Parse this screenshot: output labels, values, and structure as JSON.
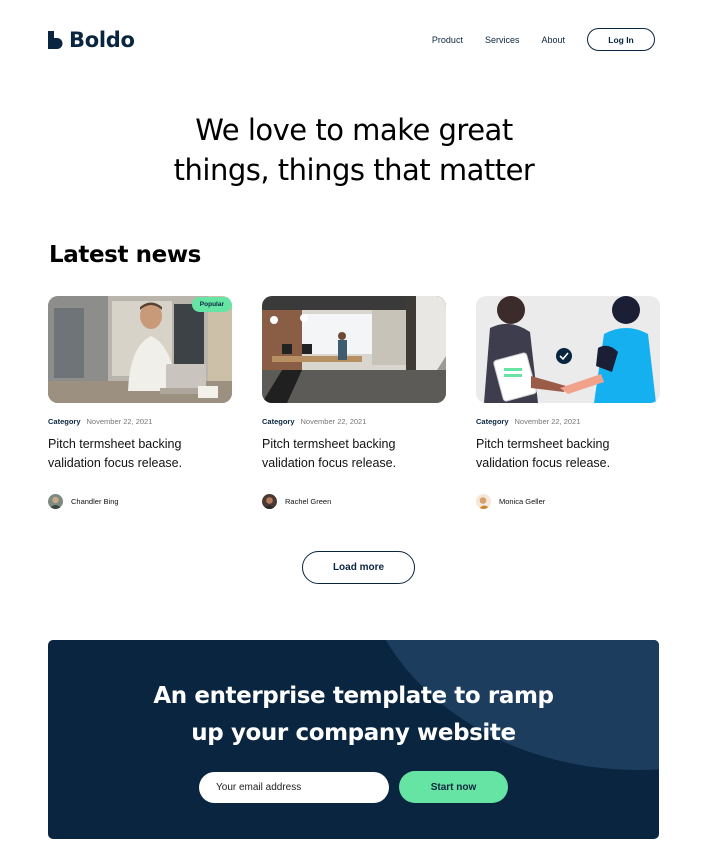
{
  "brand": {
    "name": "Boldo",
    "color": "#0a2540",
    "accent": "#65e4a3"
  },
  "nav": {
    "items": [
      {
        "label": "Product"
      },
      {
        "label": "Services"
      },
      {
        "label": "About"
      }
    ],
    "login_label": "Log In"
  },
  "hero": {
    "line1": "We love to make great",
    "line2": "things, things that matter"
  },
  "news": {
    "title": "Latest news",
    "cards": [
      {
        "badge": "Popular",
        "category": "Category",
        "date": "November 22, 2021",
        "title": "Pitch termsheet backing validation focus release.",
        "author": "Chandler Bing",
        "image": "man-with-phone-laptop"
      },
      {
        "category": "Category",
        "date": "November 22, 2021",
        "title": "Pitch termsheet backing validation focus release.",
        "author": "Rachel Green",
        "image": "office-interior"
      },
      {
        "category": "Category",
        "date": "November 22, 2021",
        "title": "Pitch termsheet backing validation focus release.",
        "author": "Monica Geller",
        "image": "handshake-illustration"
      }
    ],
    "load_more_label": "Load more"
  },
  "cta": {
    "line1": "An enterprise template to ramp",
    "line2": "up your company website",
    "email_placeholder": "Your email address",
    "button_label": "Start now"
  }
}
